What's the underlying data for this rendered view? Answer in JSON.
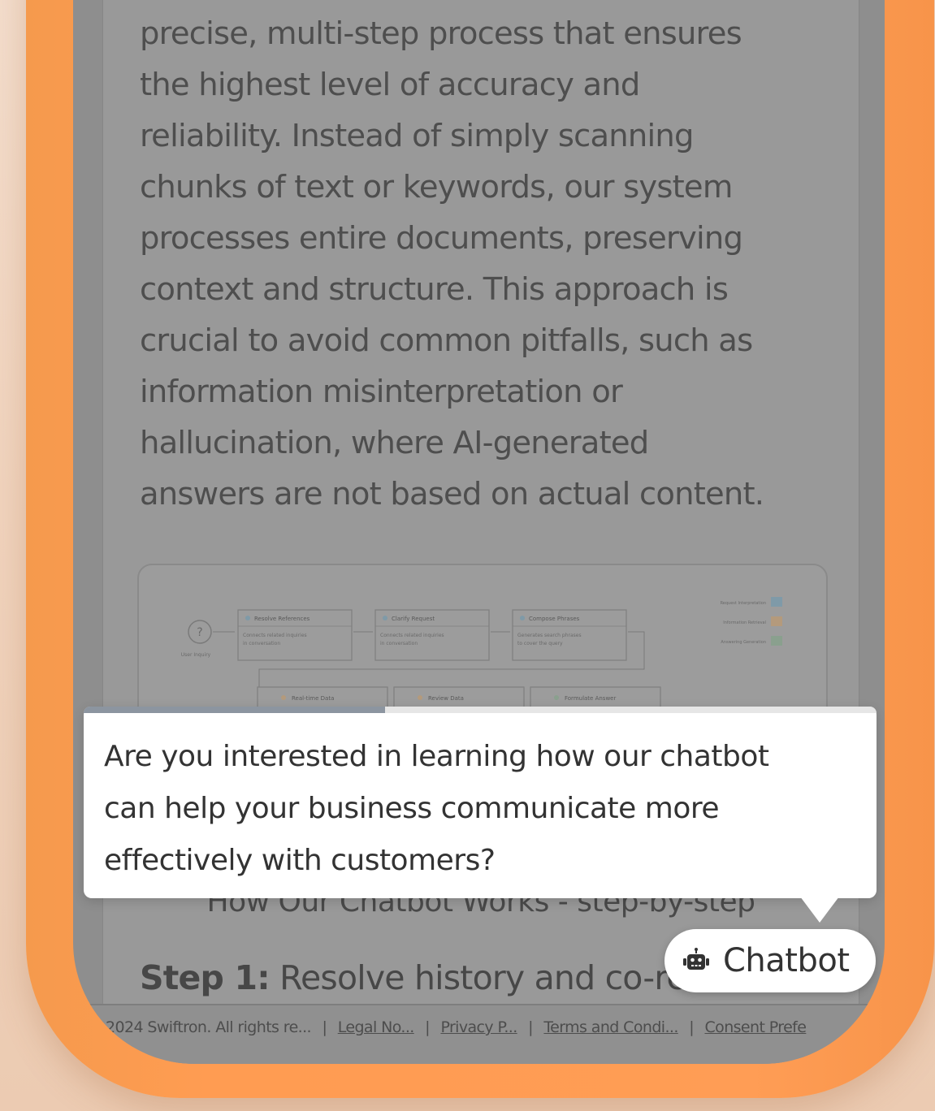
{
  "article": {
    "paragraph_lines": [
      "precise, multi-step process that ensures",
      "the highest level of accuracy and",
      "reliability. Instead of simply scanning",
      "chunks of text or keywords, our system",
      "processes entire documents, preserving",
      "context and structure. This approach is",
      "crucial to avoid common pitfalls, such as",
      "information misinterpretation or",
      "hallucination, where AI-generated",
      "answers are not based on actual content."
    ]
  },
  "diagram": {
    "top_row": [
      {
        "title": "Resolve References",
        "desc1": "Connects related inquiries",
        "desc2": "in conversation"
      },
      {
        "title": "Clarify Request",
        "desc1": "Connects related inquiries",
        "desc2": "in conversation"
      },
      {
        "title": "Compose Phrases",
        "desc1": "Generates search phrases",
        "desc2": "to cover the query"
      }
    ],
    "bottom_row": [
      "Real-time Data",
      "Review Data",
      "Formulate Answer"
    ],
    "start_label": "User Inquiry",
    "legend": [
      {
        "label": "Request Interpretation",
        "color": "#7f9aa8"
      },
      {
        "label": "Information Retrieval",
        "color": "#b49a7c"
      },
      {
        "label": "Answering Generation",
        "color": "#8aa08e"
      }
    ]
  },
  "steps": {
    "heading": "How Our Chatbot Works - step-by-step",
    "step1_label": "Step 1:",
    "step1_text": " Resolve history and co-reference"
  },
  "footer": {
    "copyright": "2024 Swiftron. All rights re...",
    "separator": "|",
    "links": [
      "Legal No...",
      "Privacy P...",
      "Terms and Condi...",
      "Consent Prefe"
    ]
  },
  "popup": {
    "message_lines": [
      "Are you interested in learning how our chatbot",
      "can help your business communicate more",
      "effectively with customers?"
    ],
    "progress": 0.38
  },
  "chatbot_button": {
    "label": "Chatbot",
    "icon": "robot-icon"
  },
  "colors": {
    "frame": "#ff9d55",
    "overlay": "#8e8e8e",
    "popup_bg": "#ffffff",
    "progress": "#8c95a0"
  }
}
